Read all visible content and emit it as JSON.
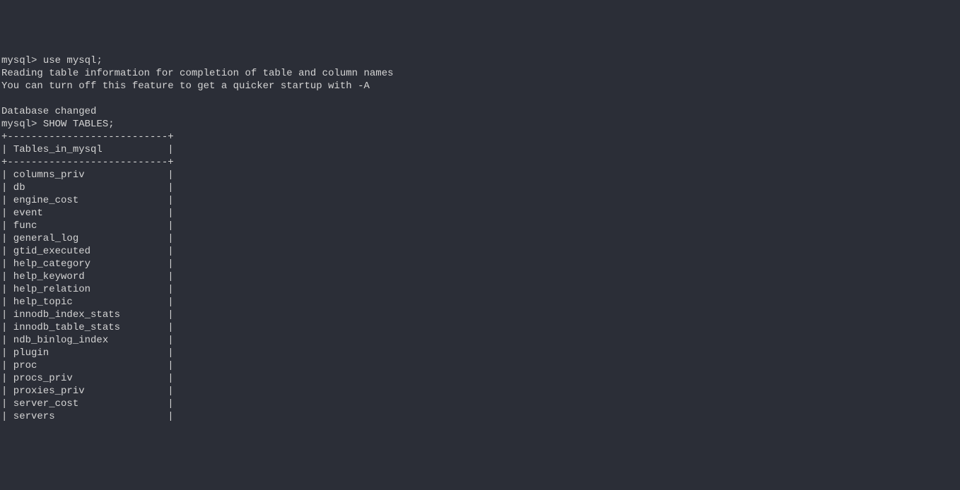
{
  "prompt": "mysql>",
  "commands": {
    "use": "use mysql;",
    "show": "SHOW TABLES;"
  },
  "messages": {
    "reading": "Reading table information for completion of table and column names",
    "turnoff": "You can turn off this feature to get a quicker startup with -A",
    "changed": "Database changed"
  },
  "table": {
    "border": "+---------------------------+",
    "header": "Tables_in_mysql",
    "rows": [
      "columns_priv",
      "db",
      "engine_cost",
      "event",
      "func",
      "general_log",
      "gtid_executed",
      "help_category",
      "help_keyword",
      "help_relation",
      "help_topic",
      "innodb_index_stats",
      "innodb_table_stats",
      "ndb_binlog_index",
      "plugin",
      "proc",
      "procs_priv",
      "proxies_priv",
      "server_cost",
      "servers"
    ]
  }
}
